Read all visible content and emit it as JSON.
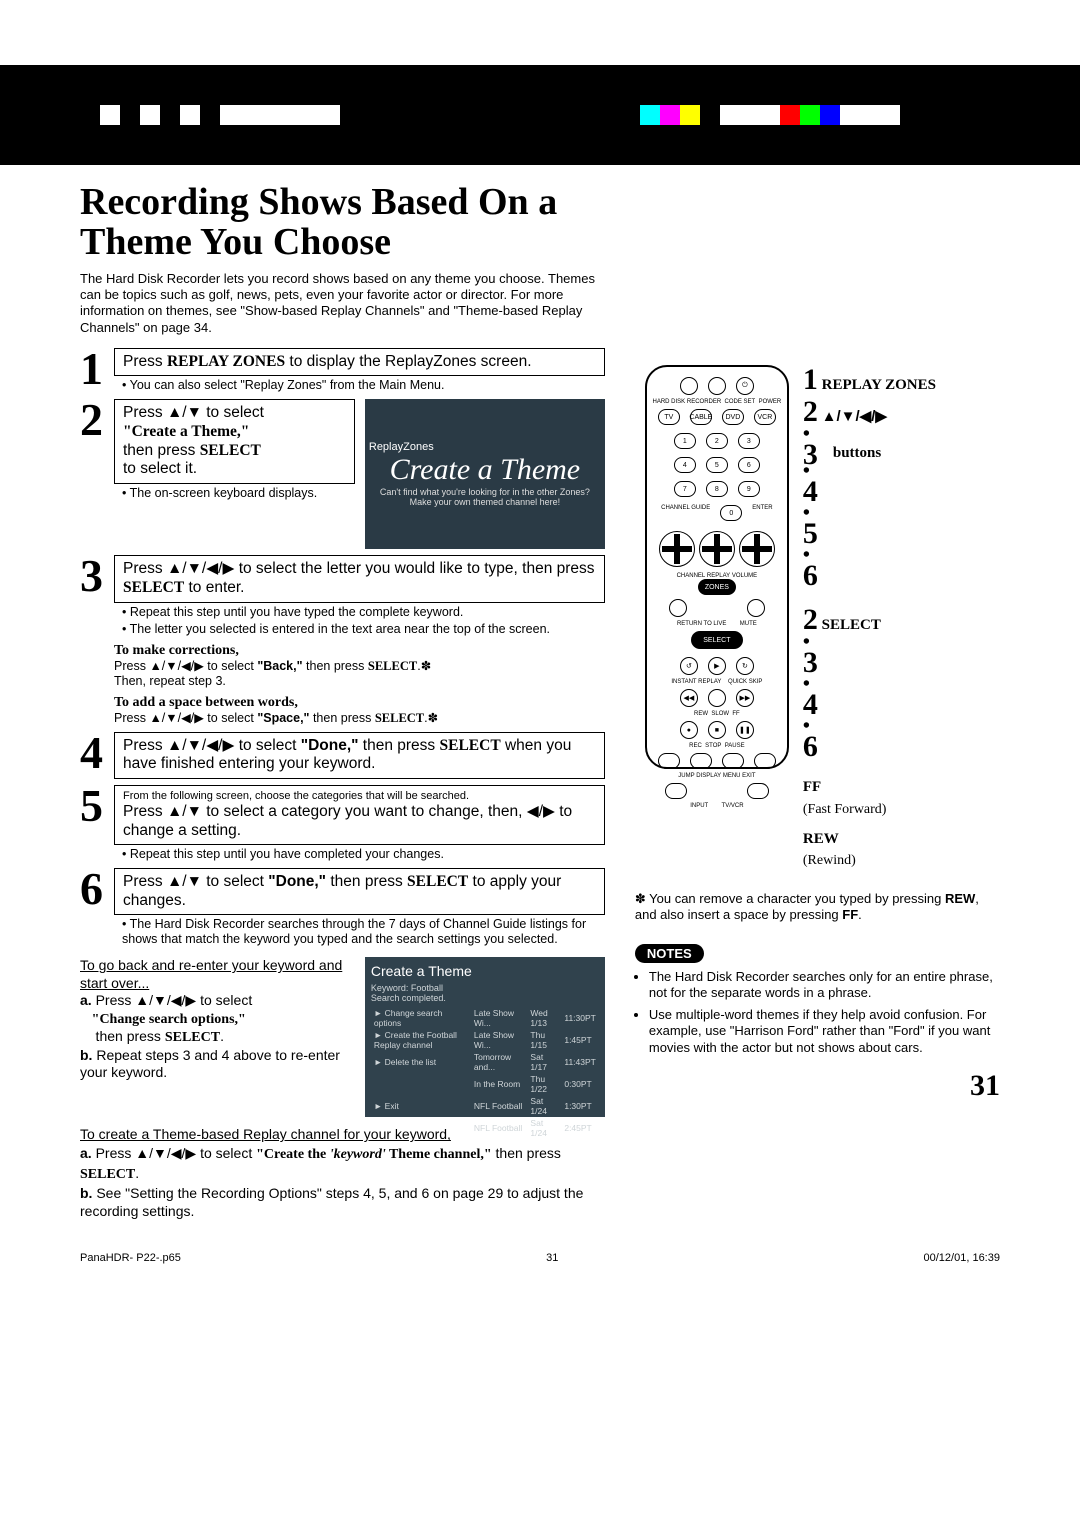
{
  "registration_bar": {
    "colors": [
      "#000",
      "#fff",
      "#000",
      "#fff",
      "#000",
      "#fff",
      "#000",
      "#fff",
      "#000",
      "#fff",
      "#000",
      "#fff",
      "#0ff",
      "#f0f",
      "#ff0",
      "#000",
      "#fff",
      "#f00",
      "#0f0",
      "#00f",
      "#000"
    ]
  },
  "title": "Recording Shows Based On a Theme You Choose",
  "intro": "The Hard Disk Recorder lets you record shows based on any theme you choose. Themes can be topics such as golf, news, pets, even your favorite actor or director. For more information on themes, see \"Show-based Replay Channels\" and \"Theme-based Replay Channels\" on page 34.",
  "steps": {
    "s1": {
      "num": "1",
      "box_pre": "Press ",
      "box_bold": "REPLAY ZONES",
      "box_post": " to display the ReplayZones screen.",
      "note": "• You can also select \"Replay Zones\" from the Main Menu."
    },
    "s2": {
      "num": "2",
      "box_line1_pre": "Press ",
      "box_line1_arrows": "▲/▼",
      "box_line1_post": " to select",
      "box_line2": "\"Create a Theme,\"",
      "box_line3_pre": "then press ",
      "box_line3_bold": "SELECT",
      "box_line4": "to select it.",
      "note": "• The on-screen keyboard displays.",
      "screenshot_title": "ReplayZones",
      "screenshot_big": "Create a Theme",
      "screenshot_caption": "Can't find what you're looking for in the other Zones? Make your own themed channel here!"
    },
    "s3": {
      "num": "3",
      "box_pre": "Press ",
      "box_arrows": "▲/▼/◀/▶",
      "box_mid": " to select the letter you would like to type, then press ",
      "box_bold": "SELECT",
      "box_post": " to enter.",
      "note1": "• Repeat this step until you have typed the complete keyword.",
      "note2": "• The letter you selected is entered in the text area near the top of the screen.",
      "sub1_h": "To make corrections,",
      "sub1_t_pre": "Press ",
      "sub1_arrows": "▲/▼/◀/▶",
      "sub1_t_mid": " to select ",
      "sub1_quoted": "\"Back,\"",
      "sub1_t_post": " then press ",
      "sub1_bold": "SELECT",
      "sub1_tail": ".✽",
      "sub1_line2": "Then, repeat step 3.",
      "sub2_h": "To add a space between words,",
      "sub2_t_pre": "Press ",
      "sub2_arrows": "▲/▼/◀/▶",
      "sub2_t_mid": " to select ",
      "sub2_quoted": "\"Space,\"",
      "sub2_t_post": " then press ",
      "sub2_bold": "SELECT",
      "sub2_tail": ".✽"
    },
    "s4": {
      "num": "4",
      "box_pre": "Press ",
      "box_arrows": "▲/▼/◀/▶",
      "box_mid": " to select ",
      "box_quoted": "\"Done,\"",
      "box_then": " then press ",
      "box_bold": "SELECT",
      "box_post": " when you have finished entering your keyword."
    },
    "s5": {
      "num": "5",
      "top_note": "From the following screen, choose the categories that will be searched.",
      "box_pre": "Press ",
      "box_arrows1": "▲/▼",
      "box_mid1": " to select a category you want to change, then, ",
      "box_arrows2": "◀/▶",
      "box_post": " to change a setting.",
      "note": "• Repeat this step until you have completed your changes."
    },
    "s6": {
      "num": "6",
      "box_pre": "Press ",
      "box_arrows": "▲/▼",
      "box_mid": " to select ",
      "box_quoted": "\"Done,\"",
      "box_then": " then press ",
      "box_bold": "SELECT",
      "box_post": " to apply your changes.",
      "note": "• The Hard Disk Recorder searches through the 7 days of Channel Guide listings for shows that match the keyword you typed and the search settings you selected."
    }
  },
  "goback": {
    "heading": "To go back and re-enter your keyword and start over...",
    "a_label": "a.",
    "a_pre": "Press ",
    "a_arrows": "▲/▼/◀/▶",
    "a_mid": " to select ",
    "a_quoted": "\"Change search options,\"",
    "a_then": " then press ",
    "a_bold": "SELECT",
    "a_tail": ".",
    "b_label": "b.",
    "b_text": "Repeat steps 3 and 4 above to re-enter your keyword."
  },
  "screenshot2": {
    "title": "Create a Theme",
    "kw_label": "Keyword:",
    "kw_value": "Football",
    "status": "Search completed.",
    "menu": [
      "Change search options",
      "Create the Football Replay channel",
      "Delete the list",
      "Exit"
    ],
    "rows": [
      [
        "Late Show Wi...",
        "Wed 1/13",
        "11:30PT"
      ],
      [
        "Late Show Wi...",
        "Thu 1/15",
        "1:45PT"
      ],
      [
        "Tomorrow and...",
        "Sat 1/17",
        "11:43PT"
      ],
      [
        "In the Room",
        "Thu 1/22",
        "0:30PT"
      ],
      [
        "NFL Football",
        "Sat 1/24",
        "1:30PT"
      ],
      [
        "NFL Football",
        "Sat 1/24",
        "2:45PT"
      ]
    ]
  },
  "createtheme": {
    "heading": "To create a Theme-based Replay channel for your keyword,",
    "a_label": "a.",
    "a_pre": "Press ",
    "a_arrows": "▲/▼/◀/▶",
    "a_mid": " to select ",
    "a_quoted_pre": "\"Create the ",
    "a_quoted_italic": "'keyword'",
    "a_quoted_post": " Theme channel,\"",
    "a_then": " then press ",
    "a_bold": "SELECT",
    "a_tail": ".",
    "b_label": "b.",
    "b_text": "See \"Setting the Recording Options\" steps 4, 5, and 6 on page 29 to adjust the recording settings."
  },
  "remote": {
    "top_labels": [
      "HARD DISK RECORDER",
      "CODE SET",
      "POWER"
    ],
    "src_row": [
      "TV",
      "CABLE",
      "DVD",
      "VCR"
    ],
    "numpad": [
      "1",
      "2",
      "3",
      "4",
      "5",
      "6",
      "7",
      "8",
      "9",
      "0"
    ],
    "guide_label": "CHANNEL GUIDE",
    "enter_label": "ENTER",
    "rocker_labels": [
      "CHANNEL",
      "REPLAY",
      "VOLUME"
    ],
    "zones_label": "ZONES",
    "return_label": "RETURN TO LIVE",
    "mute_label": "MUTE",
    "select_label": "SELECT",
    "row1": [
      "INSTANT REPLAY",
      "QUICK SKIP"
    ],
    "row2": [
      "REW",
      "SLOW",
      "FF"
    ],
    "row3": [
      "REC",
      "STOP",
      "PAUSE"
    ],
    "row4": [
      "JUMP",
      "DISPLAY",
      "MENU",
      "EXIT"
    ],
    "row5": [
      "INPUT",
      "TV/VCR"
    ]
  },
  "annotations": {
    "a1_num": "1",
    "a1_label": "REPLAY ZONES",
    "a2_num": "2",
    "a2_label_pre": "▲/▼/◀/▶",
    "a2_label_post": "buttons",
    "a_dots": [
      "3",
      "4",
      "5",
      "6"
    ],
    "b2_num": "2",
    "b2_label": "SELECT",
    "b_dots": [
      "3",
      "4",
      "6"
    ],
    "ff_label": "FF",
    "ff_sub": "(Fast Forward)",
    "rew_label": "REW",
    "rew_sub": "(Rewind)"
  },
  "asterisk": "✽ You can remove a character you typed by pressing REW, and also insert a space by pressing FF.",
  "asterisk_bold1": "REW",
  "asterisk_bold2": "FF",
  "notes_badge": "NOTES",
  "notes": [
    "The Hard Disk Recorder searches only for an entire phrase, not for the separate words in a phrase.",
    "Use multiple-word themes if they help avoid confusion. For example, use \"Harrison Ford\" rather than \"Ford\" if you want movies with the actor but not shows about cars."
  ],
  "page_number": "31",
  "footer": {
    "left": "PanaHDR- P22-.p65",
    "center": "31",
    "right": "00/12/01, 16:39"
  }
}
